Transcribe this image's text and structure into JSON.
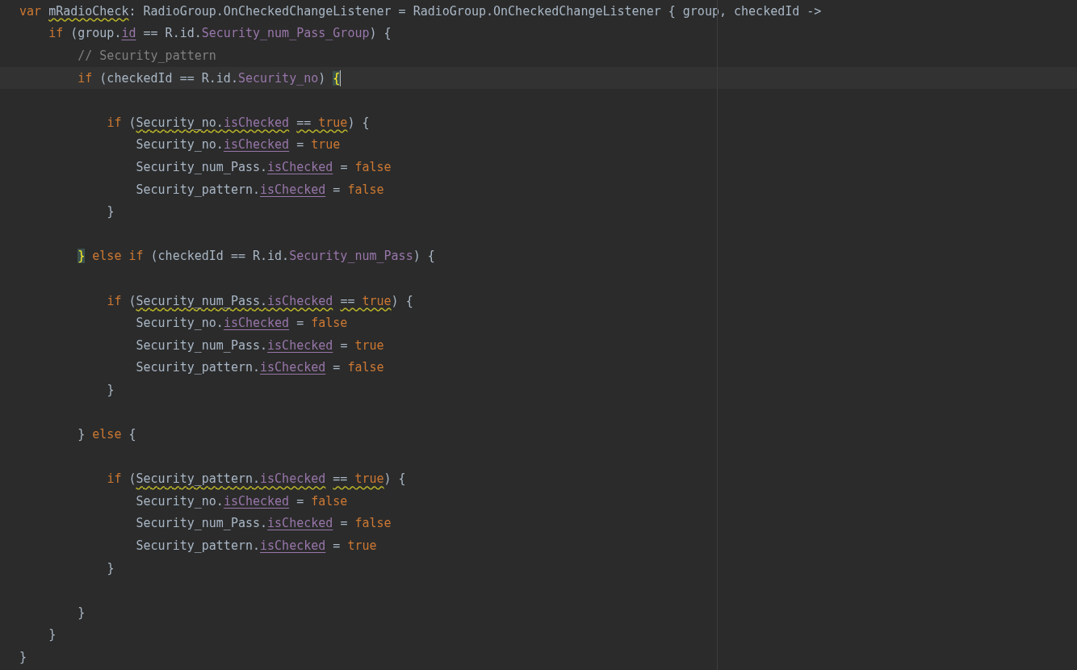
{
  "editor": {
    "lines": [
      {
        "tokens": [
          {
            "text": "var ",
            "kind": "keyword"
          },
          {
            "text": "mRadioCheck",
            "kind": "plain",
            "warning": true
          },
          {
            "text": ": RadioGroup.OnCheckedChangeListener = RadioGroup.OnCheckedChangeListener { group, checkedId ->",
            "kind": "plain"
          }
        ]
      },
      {
        "tokens": [
          {
            "text": "    if ",
            "kind": "keyword"
          },
          {
            "text": "(group.",
            "kind": "plain"
          },
          {
            "text": "id",
            "kind": "synthetic"
          },
          {
            "text": " == R.id.",
            "kind": "plain"
          },
          {
            "text": "Security_num_Pass_Group",
            "kind": "field"
          },
          {
            "text": ") {",
            "kind": "plain"
          }
        ]
      },
      {
        "tokens": [
          {
            "text": "        // Security_pattern",
            "kind": "comment"
          }
        ]
      },
      {
        "current": true,
        "tokens": [
          {
            "text": "        if ",
            "kind": "keyword"
          },
          {
            "text": "(checkedId == R.id.",
            "kind": "plain"
          },
          {
            "text": "Security_no",
            "kind": "field"
          },
          {
            "text": ") ",
            "kind": "plain"
          },
          {
            "text": "{",
            "kind": "match"
          }
        ]
      },
      {
        "gap_before": true,
        "tokens": [
          {
            "text": "            if ",
            "kind": "keyword"
          },
          {
            "text": "(",
            "kind": "plain"
          },
          {
            "text": "Security_no.",
            "kind": "plain",
            "warning": true
          },
          {
            "text": "isChecked",
            "kind": "synthetic",
            "warning": true
          },
          {
            "text": " == ",
            "kind": "plain",
            "warning": true
          },
          {
            "text": "true",
            "kind": "keyword",
            "warning": true
          },
          {
            "text": ") {",
            "kind": "plain"
          }
        ]
      },
      {
        "tokens": [
          {
            "text": "                Security_no.",
            "kind": "plain"
          },
          {
            "text": "isChecked",
            "kind": "synthetic"
          },
          {
            "text": " = ",
            "kind": "plain"
          },
          {
            "text": "true",
            "kind": "keyword"
          }
        ]
      },
      {
        "tokens": [
          {
            "text": "                Security_num_Pass.",
            "kind": "plain"
          },
          {
            "text": "isChecked",
            "kind": "synthetic"
          },
          {
            "text": " = ",
            "kind": "plain"
          },
          {
            "text": "false",
            "kind": "keyword"
          }
        ]
      },
      {
        "tokens": [
          {
            "text": "                Security_pattern.",
            "kind": "plain"
          },
          {
            "text": "isChecked",
            "kind": "synthetic"
          },
          {
            "text": " = ",
            "kind": "plain"
          },
          {
            "text": "false",
            "kind": "keyword"
          }
        ]
      },
      {
        "tokens": [
          {
            "text": "            }",
            "kind": "plain"
          }
        ]
      },
      {
        "gap_before": true,
        "tokens": [
          {
            "text": "        }",
            "kind": "match"
          },
          {
            "text": " else if ",
            "kind": "keyword"
          },
          {
            "text": "(checkedId == R.id.",
            "kind": "plain"
          },
          {
            "text": "Security_num_Pass",
            "kind": "field"
          },
          {
            "text": ") {",
            "kind": "plain"
          }
        ]
      },
      {
        "gap_before": true,
        "tokens": [
          {
            "text": "            if ",
            "kind": "keyword"
          },
          {
            "text": "(",
            "kind": "plain"
          },
          {
            "text": "Security_num_Pass.",
            "kind": "plain",
            "warning": true
          },
          {
            "text": "isChecked",
            "kind": "synthetic",
            "warning": true
          },
          {
            "text": " == ",
            "kind": "plain",
            "warning": true
          },
          {
            "text": "true",
            "kind": "keyword",
            "warning": true
          },
          {
            "text": ") {",
            "kind": "plain"
          }
        ]
      },
      {
        "tokens": [
          {
            "text": "                Security_no.",
            "kind": "plain"
          },
          {
            "text": "isChecked",
            "kind": "synthetic"
          },
          {
            "text": " = ",
            "kind": "plain"
          },
          {
            "text": "false",
            "kind": "keyword"
          }
        ]
      },
      {
        "tokens": [
          {
            "text": "                Security_num_Pass.",
            "kind": "plain"
          },
          {
            "text": "isChecked",
            "kind": "synthetic"
          },
          {
            "text": " = ",
            "kind": "plain"
          },
          {
            "text": "true",
            "kind": "keyword"
          }
        ]
      },
      {
        "tokens": [
          {
            "text": "                Security_pattern.",
            "kind": "plain"
          },
          {
            "text": "isChecked",
            "kind": "synthetic"
          },
          {
            "text": " = ",
            "kind": "plain"
          },
          {
            "text": "false",
            "kind": "keyword"
          }
        ]
      },
      {
        "tokens": [
          {
            "text": "            }",
            "kind": "plain"
          }
        ]
      },
      {
        "gap_before": true,
        "tokens": [
          {
            "text": "        } ",
            "kind": "plain"
          },
          {
            "text": "else ",
            "kind": "keyword"
          },
          {
            "text": "{",
            "kind": "plain"
          }
        ]
      },
      {
        "gap_before": true,
        "tokens": [
          {
            "text": "            if ",
            "kind": "keyword"
          },
          {
            "text": "(",
            "kind": "plain"
          },
          {
            "text": "Security_pattern.",
            "kind": "plain",
            "warning": true
          },
          {
            "text": "isChecked",
            "kind": "synthetic",
            "warning": true
          },
          {
            "text": " == ",
            "kind": "plain",
            "warning": true
          },
          {
            "text": "true",
            "kind": "keyword",
            "warning": true
          },
          {
            "text": ") {",
            "kind": "plain"
          }
        ]
      },
      {
        "tokens": [
          {
            "text": "                Security_no.",
            "kind": "plain"
          },
          {
            "text": "isChecked",
            "kind": "synthetic"
          },
          {
            "text": " = ",
            "kind": "plain"
          },
          {
            "text": "false",
            "kind": "keyword"
          }
        ]
      },
      {
        "tokens": [
          {
            "text": "                Security_num_Pass.",
            "kind": "plain"
          },
          {
            "text": "isChecked",
            "kind": "synthetic"
          },
          {
            "text": " = ",
            "kind": "plain"
          },
          {
            "text": "false",
            "kind": "keyword"
          }
        ]
      },
      {
        "tokens": [
          {
            "text": "                Security_pattern.",
            "kind": "plain"
          },
          {
            "text": "isChecked",
            "kind": "synthetic"
          },
          {
            "text": " = ",
            "kind": "plain"
          },
          {
            "text": "true",
            "kind": "keyword"
          }
        ]
      },
      {
        "tokens": [
          {
            "text": "            }",
            "kind": "plain"
          }
        ]
      },
      {
        "gap_before": true,
        "tokens": [
          {
            "text": "        }",
            "kind": "plain"
          }
        ]
      },
      {
        "tokens": [
          {
            "text": "    }",
            "kind": "plain"
          }
        ]
      },
      {
        "tokens": [
          {
            "text": "}",
            "kind": "plain"
          }
        ]
      }
    ]
  }
}
